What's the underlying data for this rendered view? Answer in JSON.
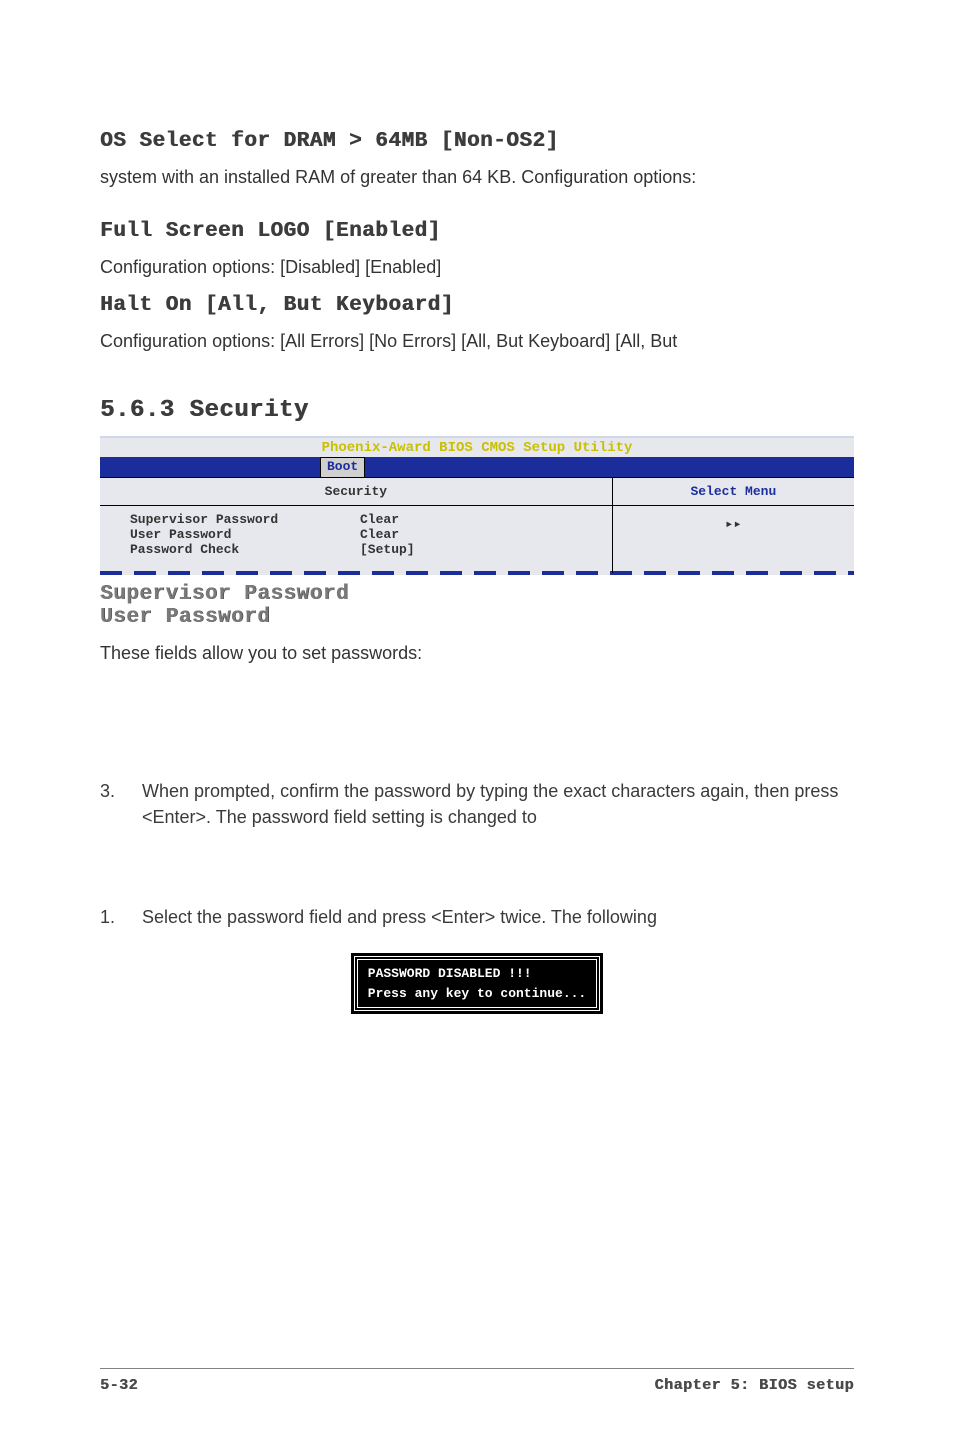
{
  "h1": "OS Select for DRAM > 64MB [Non-OS2]",
  "p1": "system with an installed RAM of greater than 64 KB. Configuration options:",
  "h2": "Full Screen LOGO [Enabled]",
  "p2": "Configuration options: [Disabled] [Enabled]",
  "h3": "Halt On [All, But Keyboard]",
  "p3": "Configuration options: [All Errors] [No Errors] [All, But Keyboard] [All, But",
  "sec_num": "5.6.3   Security",
  "bios": {
    "title": "Phoenix-Award BIOS CMOS Setup Utility",
    "tab": "Boot",
    "left_header": "Security",
    "right_header": "Select Menu",
    "right_arrow": "▸▸",
    "rows": [
      {
        "label": "Supervisor Password",
        "value": "Clear"
      },
      {
        "label": "User Password",
        "value": "Clear"
      },
      {
        "label": "Password Check",
        "value": "[Setup]"
      }
    ]
  },
  "sub1": "Supervisor Password",
  "sub2": "User Password",
  "p4": "These fields allow you to set passwords:",
  "item3_num": "3.",
  "item3_txt": "When prompted, confirm the password by typing the exact characters again, then press <Enter>. The password field setting is changed to",
  "item1_num": "1.",
  "item1_txt": "Select the password field and press <Enter> twice. The following",
  "term_l1": "PASSWORD DISABLED !!!",
  "term_l2": "Press any key to continue...",
  "footer_left": "5-32",
  "footer_right": "Chapter 5: BIOS setup"
}
